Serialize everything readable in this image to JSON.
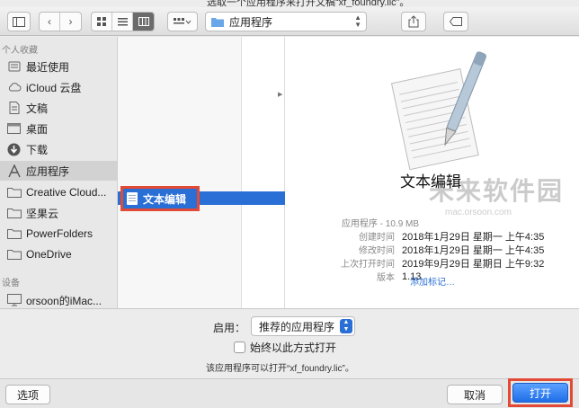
{
  "window": {
    "title": "选取一个应用程序来打开文稿“xf_foundry.lic”。"
  },
  "toolbar": {
    "nav_back_icon": "chevron-left-icon",
    "nav_forward_icon": "chevron-right-icon",
    "view_modes": [
      "icon-view",
      "list-view",
      "column-view"
    ],
    "active_view": "column-view",
    "location": "应用程序",
    "share_icon": "share-icon",
    "tag_icon": "tag-icon"
  },
  "sidebar": {
    "favorites_header": "个人收藏",
    "items": [
      {
        "label": "最近使用",
        "icon": "recents-icon"
      },
      {
        "label": "iCloud 云盘",
        "icon": "cloud-icon"
      },
      {
        "label": "文稿",
        "icon": "document-icon"
      },
      {
        "label": "桌面",
        "icon": "desktop-icon"
      },
      {
        "label": "下载",
        "icon": "download-icon"
      },
      {
        "label": "应用程序",
        "icon": "applications-icon",
        "selected": true
      },
      {
        "label": "Creative Cloud...",
        "icon": "folder-icon"
      },
      {
        "label": "坚果云",
        "icon": "folder-icon"
      },
      {
        "label": "PowerFolders",
        "icon": "folder-icon"
      },
      {
        "label": "OneDrive",
        "icon": "folder-icon"
      }
    ],
    "devices_header": "设备",
    "devices": [
      {
        "label": "orsoon的iMac...",
        "icon": "computer-icon"
      }
    ]
  },
  "browser": {
    "selected_item": "文本编辑"
  },
  "preview": {
    "name": "文本编辑",
    "info": [
      {
        "key": "应用程序 - 10.9 MB",
        "value": ""
      },
      {
        "key": "创建时间",
        "value": "2018年1月29日 星期一 上午4:35"
      },
      {
        "key": "修改时间",
        "value": "2018年1月29日 星期一 上午4:35"
      },
      {
        "key": "上次打开时间",
        "value": "2019年9月29日 星期日 上午9:32"
      },
      {
        "key": "版本",
        "value": "1.13"
      }
    ],
    "add_tags": "添加标记…",
    "watermark_cn": "未来软件园",
    "watermark_en": "mac.orsoon.com"
  },
  "options": {
    "enable_label": "启用：",
    "enable_value": "推荐的应用程序",
    "always_open": "始终以此方式打开",
    "note": "该应用程序可以打开“xf_foundry.lic”。"
  },
  "buttons": {
    "options": "选项",
    "cancel": "取消",
    "open": "打开"
  },
  "colors": {
    "accent": "#2a6fd6",
    "highlight_box": "#e24a35"
  }
}
